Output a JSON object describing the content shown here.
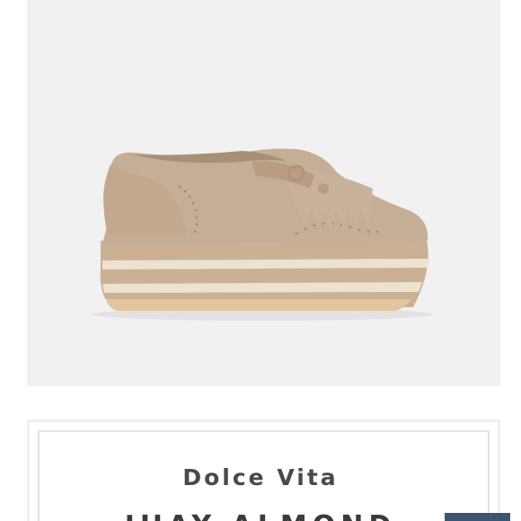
{
  "product": {
    "image_alt": "Dolce Vita platform suede loafer with fringe tassel",
    "brand": "Dolce Vita",
    "name_partial": "JHAY ALMOND"
  },
  "colors": {
    "panel_bg": "#f1f1f1",
    "suede": "#c7ae97",
    "sole_stripe_light": "#ebe0cf",
    "sole_stripe_tan": "#c9ad92",
    "brand_text": "#4a4a4a",
    "corner_tab": "#3d566e"
  }
}
